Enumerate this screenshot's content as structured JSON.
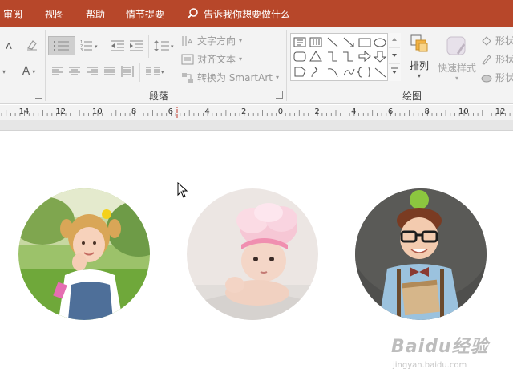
{
  "menu": {
    "tabs": [
      {
        "label": "审阅"
      },
      {
        "label": "视图"
      },
      {
        "label": "帮助"
      },
      {
        "label": "情节提要"
      }
    ],
    "tell_me": "告诉我你想要做什么"
  },
  "ribbon": {
    "paragraph": {
      "group_label": "段落",
      "text_direction": "文字方向",
      "align_text": "对齐文本",
      "convert_smartart": "转换为 SmartArt"
    },
    "drawing": {
      "group_label": "绘图",
      "arrange": "排列",
      "quick_styles": "快速样式",
      "shape_fill": "形状",
      "shape_outline": "形状",
      "shape_effects": "形状"
    },
    "font_letter_1": "A",
    "font_letter_2": "A"
  },
  "ruler": {
    "labels": [
      "14",
      "12",
      "10",
      "8",
      "6",
      "4",
      "2",
      "0",
      "2",
      "4",
      "6",
      "8",
      "10",
      "12"
    ]
  },
  "slide": {
    "photos": [
      {
        "name": "girl-photo"
      },
      {
        "name": "baby-photo"
      },
      {
        "name": "boy-photo"
      }
    ]
  },
  "watermark": {
    "text": "Baidu经验",
    "sub": "jingyan.baidu.com"
  },
  "colors": {
    "menubar": "#b7472a",
    "ribbon": "#f3f3f3"
  }
}
